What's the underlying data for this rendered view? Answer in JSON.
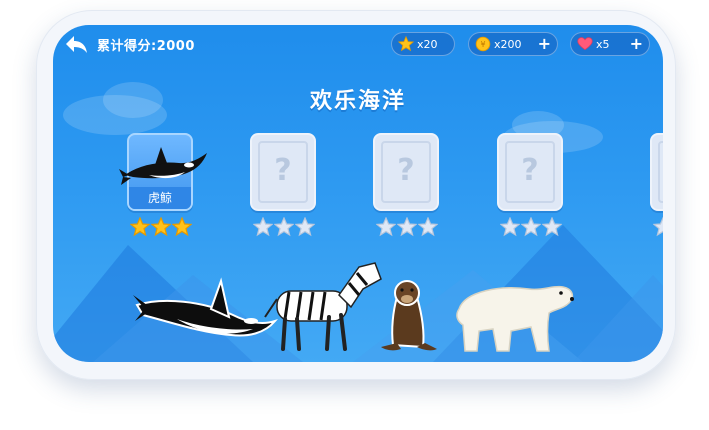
{
  "header": {
    "score_label": "累计得分:2000",
    "stars": {
      "value": "x20"
    },
    "coins": {
      "value": "x200",
      "plus": "+"
    },
    "lives": {
      "value": "x5",
      "plus": "+"
    }
  },
  "title": "欢乐海洋",
  "levels": [
    {
      "label": "虎鲸",
      "unlocked": true,
      "stars_earned": 3
    },
    {
      "label": "?",
      "unlocked": false,
      "stars_earned": 0
    },
    {
      "label": "?",
      "unlocked": false,
      "stars_earned": 0
    },
    {
      "label": "?",
      "unlocked": false,
      "stars_earned": 0
    },
    {
      "label": "?",
      "unlocked": false,
      "stars_earned": 0
    }
  ],
  "animals": [
    "orca",
    "zebra",
    "sea-otter",
    "polar-bear"
  ],
  "colors": {
    "sky": "#2d99f1",
    "star_gold": "#ffc21a",
    "star_empty": "#dfe8f6"
  }
}
